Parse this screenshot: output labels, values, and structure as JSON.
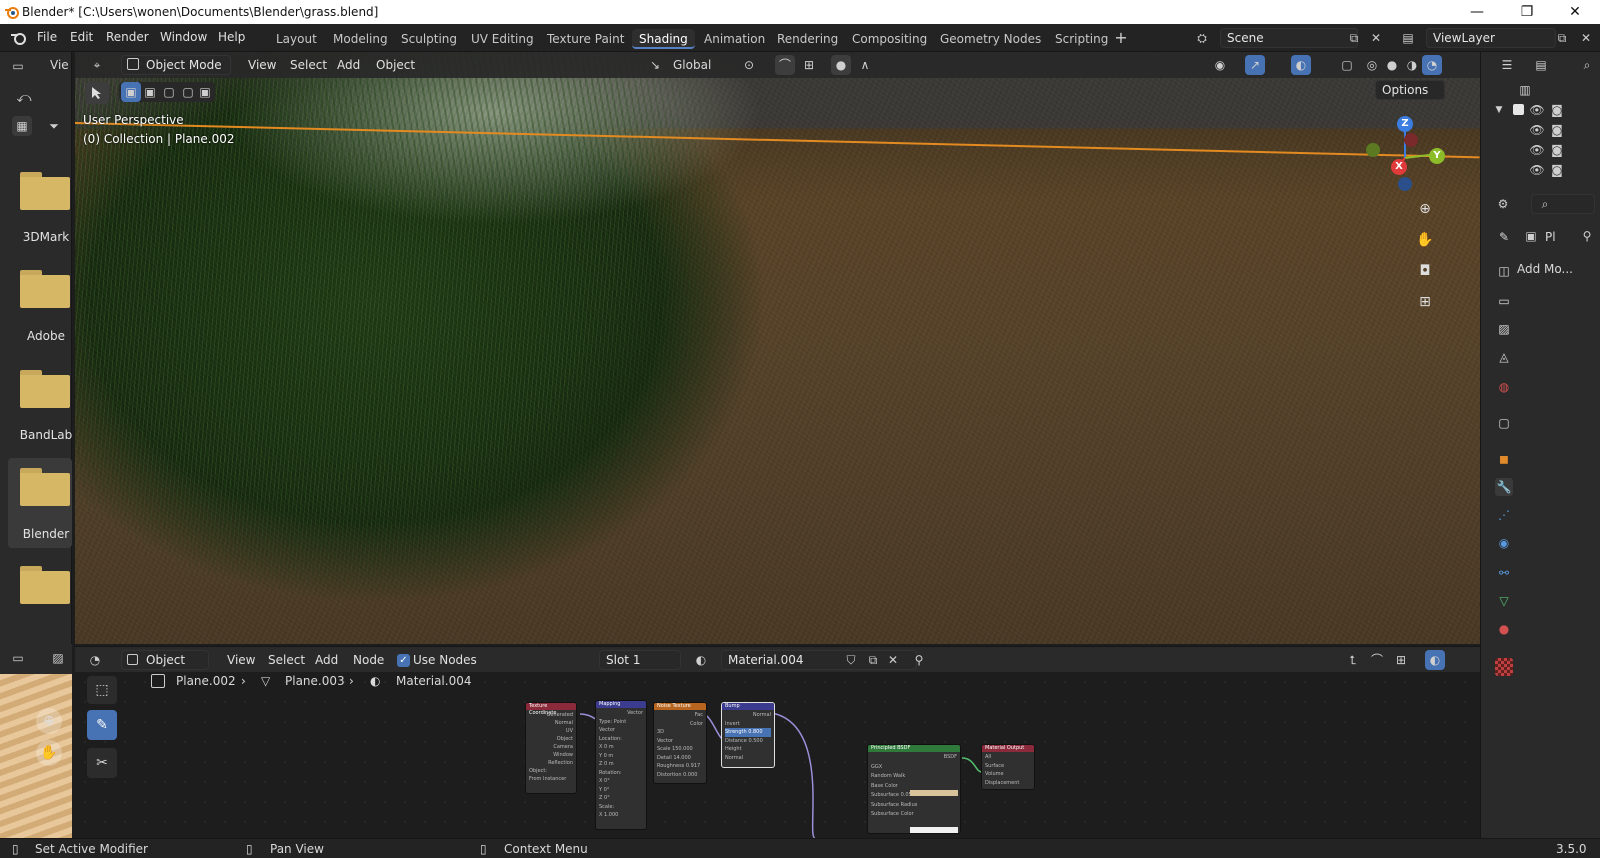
{
  "window": {
    "title": "Blender* [C:\\Users\\wonen\\Documents\\Blender\\grass.blend]",
    "controls": [
      "—",
      "❐",
      "✕"
    ]
  },
  "menu": [
    "File",
    "Edit",
    "Render",
    "Window",
    "Help"
  ],
  "workspaces": [
    "Layout",
    "Modeling",
    "Sculpting",
    "UV Editing",
    "Texture Paint",
    "Shading",
    "Animation",
    "Rendering",
    "Compositing",
    "Geometry Nodes",
    "Scripting"
  ],
  "active_workspace": "Shading",
  "scene": {
    "label": "Scene"
  },
  "view_layer": {
    "label": "ViewLayer"
  },
  "file_browser": {
    "view_label": "Vie",
    "folders": [
      "3DMark",
      "Adobe",
      "BandLab",
      "Blender"
    ]
  },
  "viewport": {
    "mode": "Object Mode",
    "menus": [
      "View",
      "Select",
      "Add",
      "Object"
    ],
    "transform": "Global",
    "options_label": "Options",
    "overlay_title": "User Perspective",
    "overlay_sub": "(0) Collection | Plane.002",
    "gizmo_axes": [
      "Z",
      "Y",
      "X"
    ]
  },
  "properties": {
    "object_short": "Pl",
    "add_modifier": "Add Mo..."
  },
  "node_editor": {
    "editor": "Object",
    "menus": [
      "View",
      "Select",
      "Add",
      "Node"
    ],
    "use_nodes_label": "Use Nodes",
    "use_nodes_checked": true,
    "slot": "Slot 1",
    "material": "Material.004",
    "breadcrumb": [
      "Plane.002",
      "Plane.003",
      "Material.004"
    ],
    "nodes": [
      {
        "title": "Texture Coordinate",
        "color": "#8a2a3a",
        "rows": [
          "Generated",
          "Normal",
          "UV",
          "Object",
          "Camera",
          "Window",
          "Reflection",
          "Object:",
          "From Instancer"
        ]
      },
      {
        "title": "Mapping",
        "color": "#3b3b8f",
        "rows": [
          "Vector",
          "Type: Point",
          "Vector",
          "Location:",
          "X 0 m",
          "Y 0 m",
          "Z 0 m",
          "Rotation:",
          "X 0°",
          "Y 0°",
          "Z 0°",
          "Scale:",
          "X 1.000"
        ]
      },
      {
        "title": "Noise Texture",
        "color": "#b8661f",
        "rows": [
          "Fac",
          "Color",
          "3D",
          "Vector",
          "Scale 150.000",
          "Detail 14.000",
          "Roughness 0.917",
          "Distortion 0.000"
        ]
      },
      {
        "title": "Bump",
        "color": "#3b3b8f",
        "rows": [
          "Normal",
          "Invert",
          "Strength 0.800",
          "Distance 0.500",
          "Height",
          "Normal"
        ]
      },
      {
        "title": "Principled BSDF",
        "color": "#2f7a3a",
        "rows": [
          "BSDF",
          "GGX",
          "Random Walk",
          "Base Color",
          "Subsurface 0.051",
          "Subsurface Radius",
          "Subsurface Color"
        ]
      },
      {
        "title": "Material Output",
        "color": "#8a2a3a",
        "rows": [
          "All",
          "Surface",
          "Volume",
          "Displacement"
        ]
      }
    ]
  },
  "status": {
    "left": "Set Active Modifier",
    "middle": "Pan View",
    "right": "Context Menu",
    "version": "3.5.0"
  },
  "colors": {
    "accent": "#4772b3",
    "horizon": "#e38a20",
    "folder": "#d6b765"
  }
}
